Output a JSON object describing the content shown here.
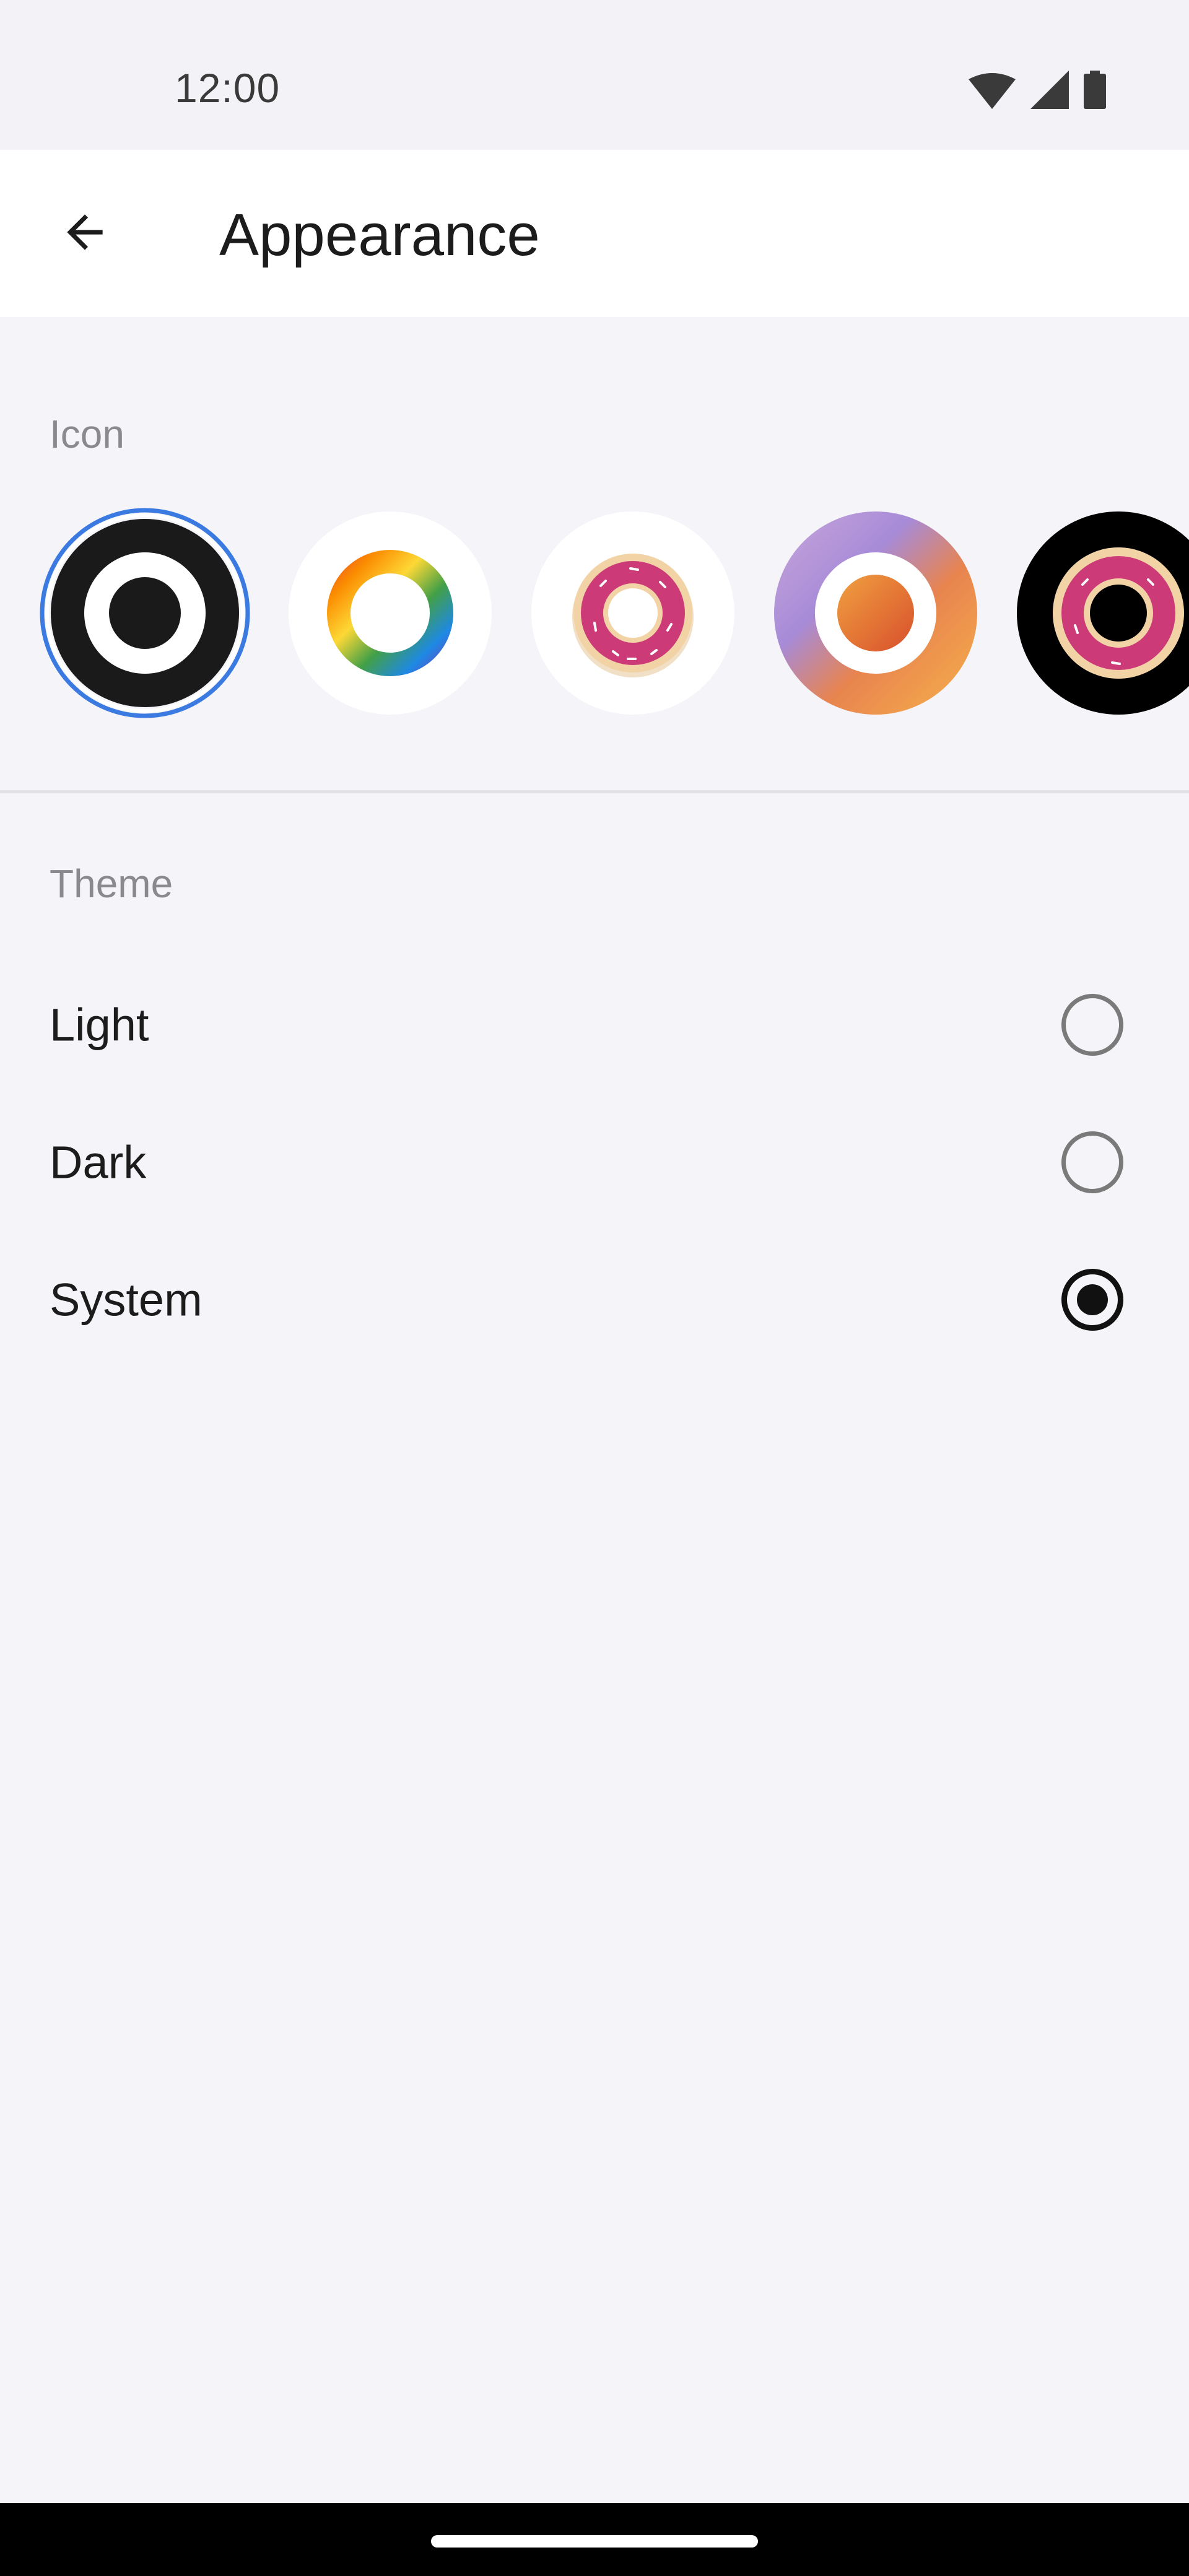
{
  "status_bar": {
    "time": "12:00",
    "icons": [
      "wifi-icon",
      "cellular-signal-icon",
      "battery-icon"
    ]
  },
  "app_bar": {
    "back_icon": "arrow-back-icon",
    "title": "Appearance"
  },
  "icon_section": {
    "label": "Icon",
    "selected_index": 0,
    "options": [
      {
        "name": "icon-option-default",
        "style": "black ring"
      },
      {
        "name": "icon-option-rainbow",
        "style": "rainbow ring"
      },
      {
        "name": "icon-option-donut",
        "style": "pink donut on white"
      },
      {
        "name": "icon-option-gradient",
        "style": "orange ring on purple-orange gradient"
      },
      {
        "name": "icon-option-donut-dark",
        "style": "pink donut on black"
      }
    ]
  },
  "theme_section": {
    "label": "Theme",
    "options": [
      {
        "label": "Light",
        "checked": false
      },
      {
        "label": "Dark",
        "checked": false
      },
      {
        "label": "System",
        "checked": true
      }
    ]
  },
  "colors": {
    "background": "#f4f4f9",
    "app_bar": "#ffffff",
    "selection_ring": "#3b7ae0",
    "text_primary": "#1c1c1c",
    "text_secondary": "#8a8a8e"
  }
}
